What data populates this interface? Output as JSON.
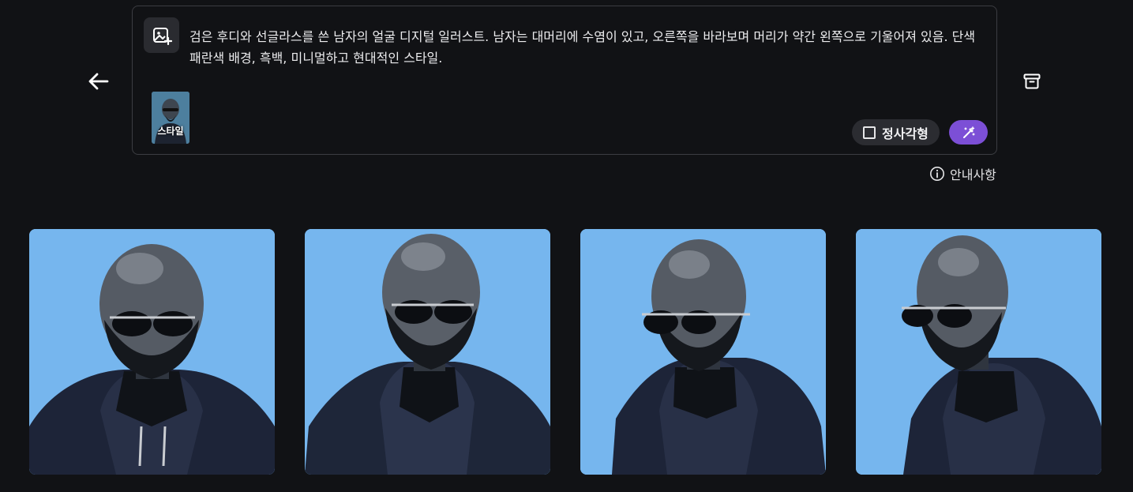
{
  "prompt": {
    "text": "검은 후디와 선글라스를 쓴 남자의 얼굴 디지털 일러스트. 남자는 대머리에 수염이 있고, 오른쪽을 바라보며 머리가 약간 왼쪽으로 기울어져 있음. 단색 패란색 배경, 흑백, 미니멀하고 현대적인 스타일."
  },
  "style_chip": {
    "label": "스타일"
  },
  "aspect_option": {
    "label": "정사각형",
    "checked": false
  },
  "notice": {
    "label": "안내사항"
  },
  "icons": {
    "back": "arrow-left-icon",
    "archive": "archive-icon",
    "add_image": "image-plus-icon",
    "generate": "magic-wand-icon",
    "info": "info-icon"
  },
  "colors": {
    "background": "#111215",
    "accent": "#7c4fd6",
    "image_bg": "#76b6ee"
  },
  "results": [
    {
      "id": "result-1"
    },
    {
      "id": "result-2"
    },
    {
      "id": "result-3"
    },
    {
      "id": "result-4"
    }
  ]
}
